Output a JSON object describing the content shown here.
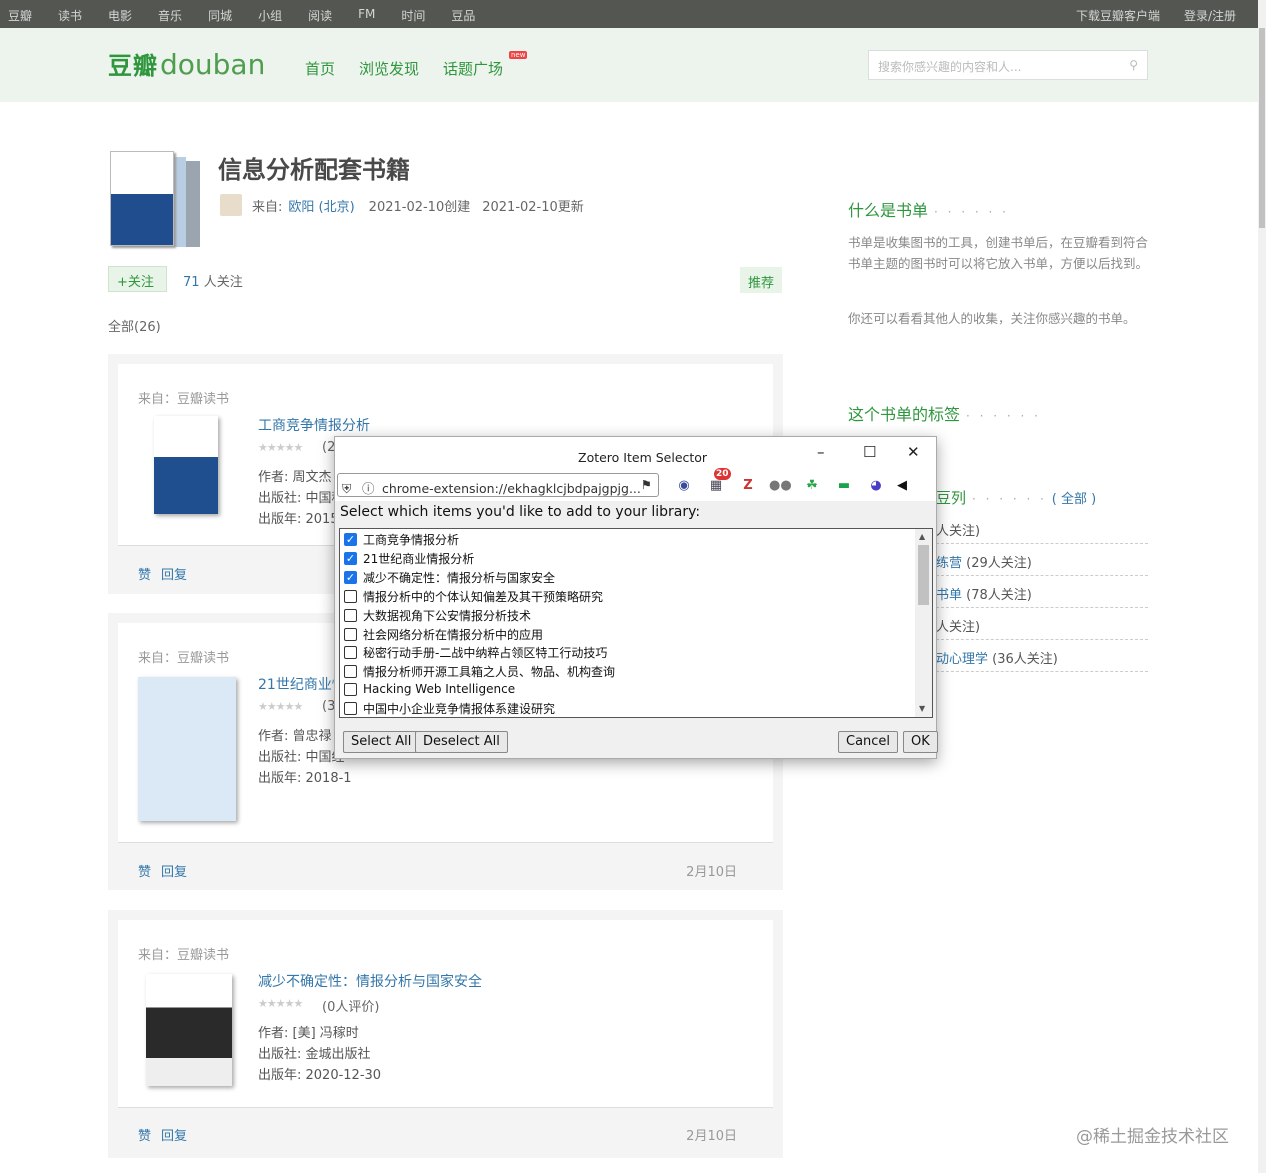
{
  "topnav": {
    "items": [
      "豆瓣",
      "读书",
      "电影",
      "音乐",
      "同城",
      "小组",
      "阅读",
      "FM",
      "时间",
      "豆品"
    ],
    "right": [
      "下载豆瓣客户端",
      "登录/注册"
    ]
  },
  "header": {
    "logo_cn": "豆瓣",
    "logo_en": "douban",
    "nav": [
      "首页",
      "浏览发现",
      "话题广场"
    ],
    "new_badge": "new",
    "search_placeholder": "搜索你感兴趣的内容和人..."
  },
  "doulist": {
    "title": "信息分析配套书籍",
    "from_label": "来自:",
    "author": "欧阳 (北京)",
    "created": "2021-02-10创建",
    "updated": "2021-02-10更新",
    "follow_label": "关注",
    "follow_count": "71",
    "follow_suffix": "人关注",
    "recommend_label": "推荐",
    "total": "全部(26)"
  },
  "items": [
    {
      "source": "来自：豆瓣读书",
      "title": "工商竞争情报分析",
      "rating": "(2",
      "author": "作者: 周文杰",
      "publisher": "出版社: 中国科",
      "year": "出版年: 2015",
      "like": "赞",
      "reply": "回复",
      "date": ""
    },
    {
      "source": "来自：豆瓣读书",
      "title": "21世纪商业情",
      "rating": "(3",
      "author": "作者: 曾忠禄",
      "publisher": "出版社: 中国经",
      "year": "出版年: 2018-1",
      "like": "赞",
      "reply": "回复",
      "date": "2月10日"
    },
    {
      "source": "来自：豆瓣读书",
      "title": "减少不确定性：情报分析与国家安全",
      "rating": "(0人评价)",
      "author": "作者: [美] 冯稼时",
      "publisher": "出版社: 金城出版社",
      "year": "出版年: 2020-12-30",
      "like": "赞",
      "reply": "回复",
      "date": "2月10日"
    }
  ],
  "sidebar": {
    "what_title": "什么是书单",
    "what_text1": "书单是收集图书的工具，创建书单后，在豆瓣看到符合书单主题的图书时可以将它放入书单，方便以后找到。",
    "what_text2": "你还可以看看其他人的收集，关注你感兴趣的书单。",
    "tags_title": "这个书单的标签",
    "series_title": "豆列",
    "series_all": "( 全部 )",
    "rows": [
      {
        "link": "",
        "count": "人关注)"
      },
      {
        "link": "练营",
        "count": "(29人关注)"
      },
      {
        "link": "书单",
        "count": "(78人关注)"
      },
      {
        "link": "",
        "count": "人关注)"
      },
      {
        "link": "动心理学",
        "count": "(36人关注)"
      }
    ]
  },
  "dialog": {
    "title": "Zotero Item Selector",
    "url": "chrome-extension://ekhagklcjbdpajgpjg...",
    "badge": "20",
    "instruction": "Select which items you'd like to add to your library:",
    "items": [
      {
        "label": "工商竞争情报分析",
        "checked": true
      },
      {
        "label": "21世纪商业情报分析",
        "checked": true
      },
      {
        "label": "减少不确定性：情报分析与国家安全",
        "checked": true
      },
      {
        "label": "情报分析中的个体认知偏差及其干预策略研究",
        "checked": false
      },
      {
        "label": "大数据视角下公安情报分析技术",
        "checked": false
      },
      {
        "label": "社会网络分析在情报分析中的应用",
        "checked": false
      },
      {
        "label": "秘密行动手册-二战中纳粹占领区特工行动技巧",
        "checked": false
      },
      {
        "label": "情报分析师开源工具箱之人员、物品、机构查询",
        "checked": false
      },
      {
        "label": "Hacking Web Intelligence",
        "checked": false
      },
      {
        "label": "中国中小企业竞争情报体系建设研究",
        "checked": false
      }
    ],
    "select_all": "Select All",
    "deselect_all": "Deselect All",
    "cancel": "Cancel",
    "ok": "OK"
  },
  "watermark": "@稀土掘金技术社区"
}
